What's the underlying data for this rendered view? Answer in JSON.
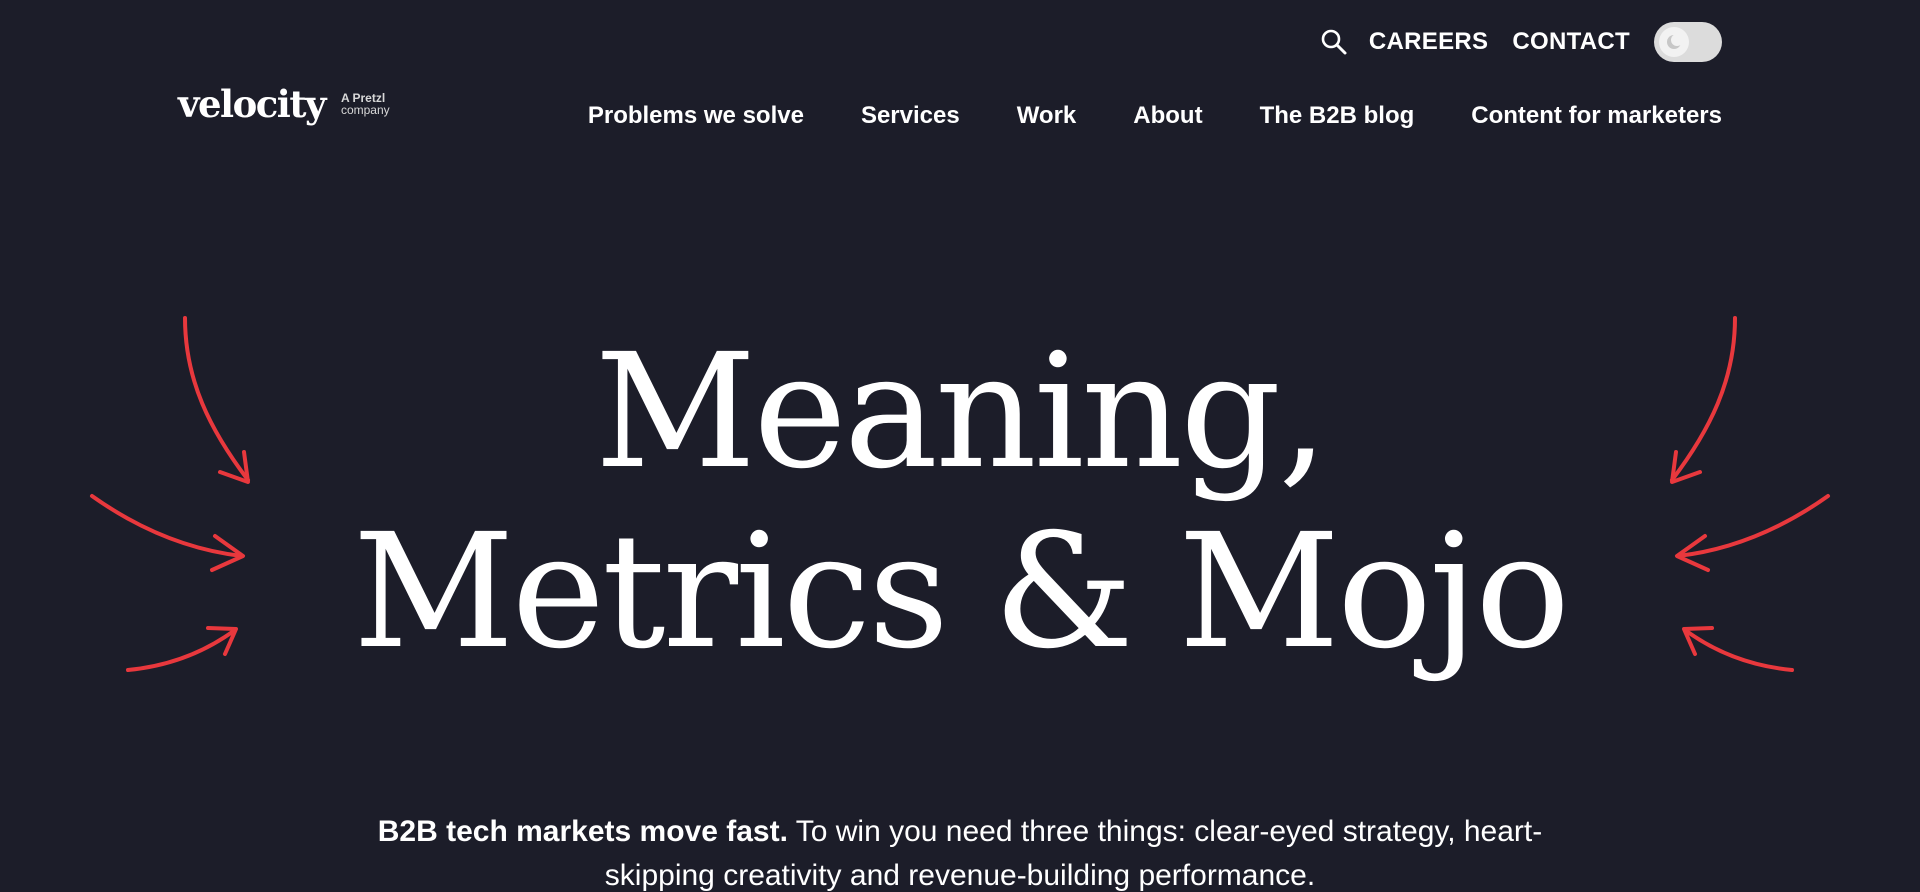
{
  "utility": {
    "search_icon": "search-icon",
    "careers": "CAREERS",
    "contact": "CONTACT",
    "theme_toggle_icon": "moon-icon"
  },
  "logo": {
    "wordmark": "velocity",
    "tag_line1": "A Pretzl",
    "tag_line2": "company"
  },
  "nav": {
    "items": [
      {
        "label": "Problems we solve"
      },
      {
        "label": "Services"
      },
      {
        "label": "Work"
      },
      {
        "label": "About"
      },
      {
        "label": "The B2B blog"
      },
      {
        "label": "Content for marketers"
      }
    ]
  },
  "hero": {
    "line1": "Meaning,",
    "line2": "Metrics & Mojo",
    "decoration_icon": "arrows-icon"
  },
  "intro": {
    "bold": "B2B tech markets move fast.",
    "rest": " To win you need three things: clear-eyed strategy, heart-skipping creativity and revenue-building performance."
  },
  "colors": {
    "background": "#1c1d29",
    "text": "#ffffff",
    "accent": "#e8383d",
    "toggle": "#dcdcdc"
  }
}
